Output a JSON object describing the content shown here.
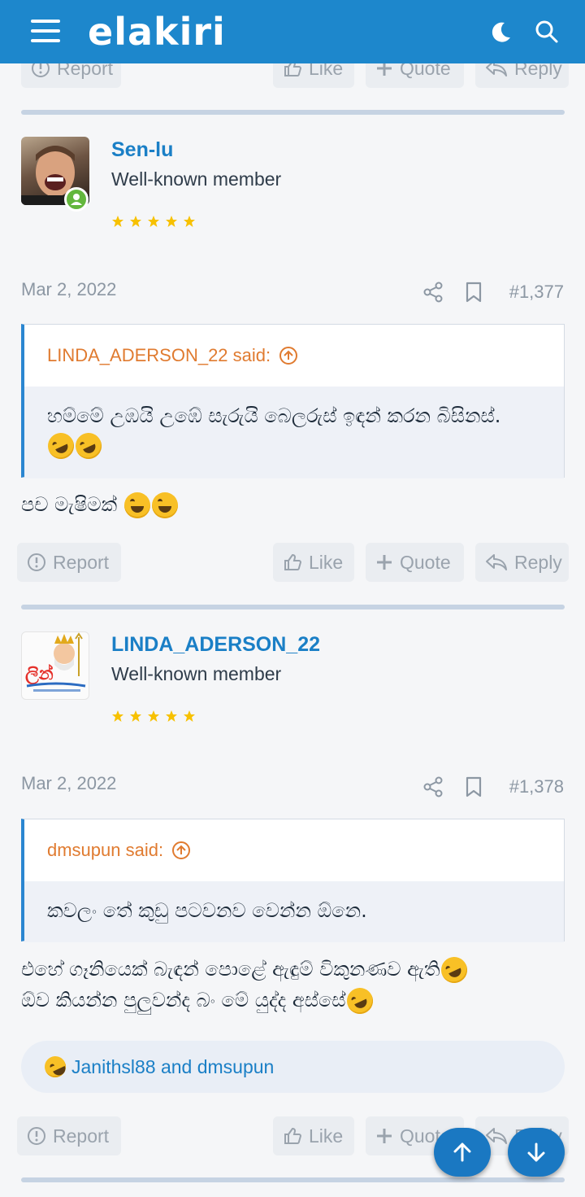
{
  "header": {
    "logo": "elakiri"
  },
  "buttons": {
    "report": "Report",
    "like": "Like",
    "quote": "Quote",
    "reply": "Reply"
  },
  "posts": [
    {
      "username": "Sen-lu",
      "title": "Well-known member",
      "date": "Mar 2, 2022",
      "number": "#1,377",
      "quote_author": "LINDA_ADERSON_22 said:",
      "quote_text": "හම්මේ උඹයි උඹේ සැරුයි බෙලරුස් ඉඳන් කරන බිසිනස්.",
      "message": "පච මැෂිමක්"
    },
    {
      "username": "LINDA_ADERSON_22",
      "title": "Well-known member",
      "date": "Mar 2, 2022",
      "number": "#1,378",
      "quote_author": "dmsupun said:",
      "quote_text": "කවලං තේ කුඩු පටවනව වෙන්න ඕනෙ.",
      "message_line1": "එහේ ගෑනියෙක් බැඳන් පොළේ ඇඳුම් විකුනණව ඇති",
      "message_line2": "ඕව කියන්න පුලුවන්ද බං මේ යුද්ද අස්සේ",
      "reactions": "Janithsl88 and dmsupun"
    }
  ],
  "colors": {
    "header": "#1d87cc",
    "link": "#1a7fc6",
    "quote_author": "#e07b30"
  }
}
